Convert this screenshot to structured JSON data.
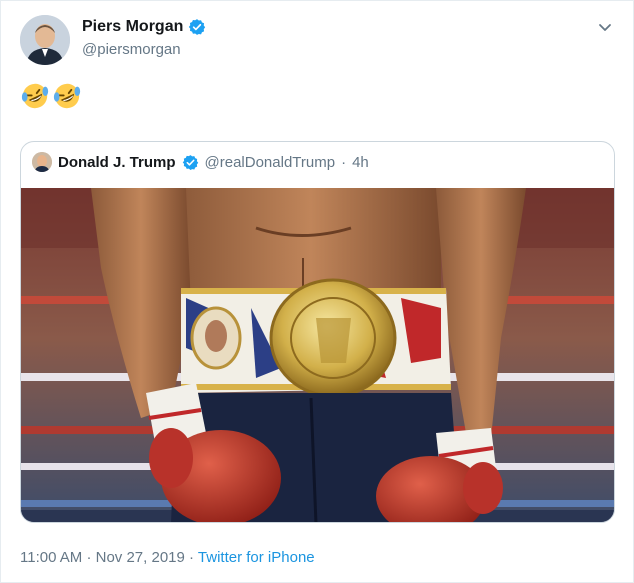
{
  "author": {
    "display_name": "Piers Morgan",
    "handle": "@piersmorgan",
    "verified": true
  },
  "tweet": {
    "emoji": [
      "rolling-on-floor-laughing",
      "rolling-on-floor-laughing"
    ]
  },
  "quoted_tweet": {
    "display_name": "Donald J. Trump",
    "handle": "@realDonaldTrump",
    "separator": "·",
    "age": "4h",
    "verified": true,
    "media": "boxer-with-championship-belt-image"
  },
  "meta": {
    "time": "11:00 AM",
    "dot": "·",
    "date": "Nov 27, 2019",
    "source": "Twitter for iPhone"
  },
  "colors": {
    "link": "#1b95e0",
    "verified": "#1da1f2",
    "secondary_text": "#657786"
  }
}
